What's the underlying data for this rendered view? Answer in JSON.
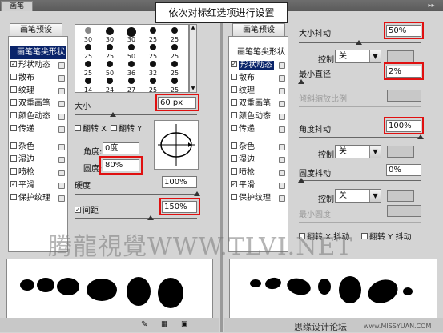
{
  "caption": "依次对标红选项进行设置",
  "window": {
    "tab": "画笔"
  },
  "left": {
    "preset_button": "画笔预设",
    "sidebar": [
      {
        "label": "画笔笔尖形状",
        "selected": true,
        "checkbox": false
      },
      {
        "label": "形状动态",
        "checked": true
      },
      {
        "label": "散布",
        "checked": false
      },
      {
        "label": "纹理",
        "checked": false
      },
      {
        "label": "双重画笔",
        "checked": false
      },
      {
        "label": "颜色动态",
        "checked": false
      },
      {
        "label": "传递",
        "checked": false
      },
      {
        "label": "杂色",
        "checked": false
      },
      {
        "label": "湿边",
        "checked": false
      },
      {
        "label": "喷枪",
        "checked": false
      },
      {
        "label": "平滑",
        "checked": true
      },
      {
        "label": "保护纹理",
        "checked": false
      }
    ],
    "brush_sizes": [
      "30",
      "30",
      "30",
      "25",
      "25",
      "25",
      "25",
      "50",
      "25",
      "25",
      "25",
      "50",
      "36",
      "32",
      "25",
      "14",
      "24",
      "27",
      "25",
      "25"
    ],
    "size_label": "大小",
    "size_value": "60 px",
    "flip_x": "翻转 X",
    "flip_y": "翻转 Y",
    "angle_label": "角度:",
    "angle_value": "0度",
    "roundness_label": "圆度:",
    "roundness_value": "80%",
    "hardness_label": "硬度",
    "hardness_value": "100%",
    "spacing_label": "间距",
    "spacing_value": "150%"
  },
  "right": {
    "preset_button": "画笔预设",
    "sidebar": [
      {
        "label": "画笔笔尖形状",
        "checkbox": false
      },
      {
        "label": "形状动态",
        "checked": true,
        "selected": true
      },
      {
        "label": "散布",
        "checked": false
      },
      {
        "label": "纹理",
        "checked": false
      },
      {
        "label": "双重画笔",
        "checked": false
      },
      {
        "label": "颜色动态",
        "checked": false
      },
      {
        "label": "传递",
        "checked": false
      },
      {
        "label": "杂色",
        "checked": false
      },
      {
        "label": "湿边",
        "checked": false
      },
      {
        "label": "喷枪",
        "checked": false
      },
      {
        "label": "平滑",
        "checked": true
      },
      {
        "label": "保护纹理",
        "checked": false
      }
    ],
    "size_jitter_label": "大小抖动",
    "size_jitter_value": "50%",
    "control_label": "控制:",
    "control_value": "关",
    "min_diameter_label": "最小直径",
    "min_diameter_value": "2%",
    "tilt_scale_label": "倾斜缩放比例",
    "angle_jitter_label": "角度抖动",
    "angle_jitter_value": "100%",
    "roundness_jitter_label": "圆度抖动",
    "roundness_jitter_value": "0%",
    "min_roundness_label": "最小圆度",
    "flip_x_jitter": "翻转 X 抖动",
    "flip_y_jitter": "翻转 Y 抖动"
  },
  "watermark": "腾龍視覺WWW.TLVI.NET",
  "footer": {
    "site": "思缘设计论坛",
    "url": "www.MISSYUAN.COM"
  },
  "colors": {
    "highlight": "#e01010",
    "selection": "#0a246a"
  }
}
